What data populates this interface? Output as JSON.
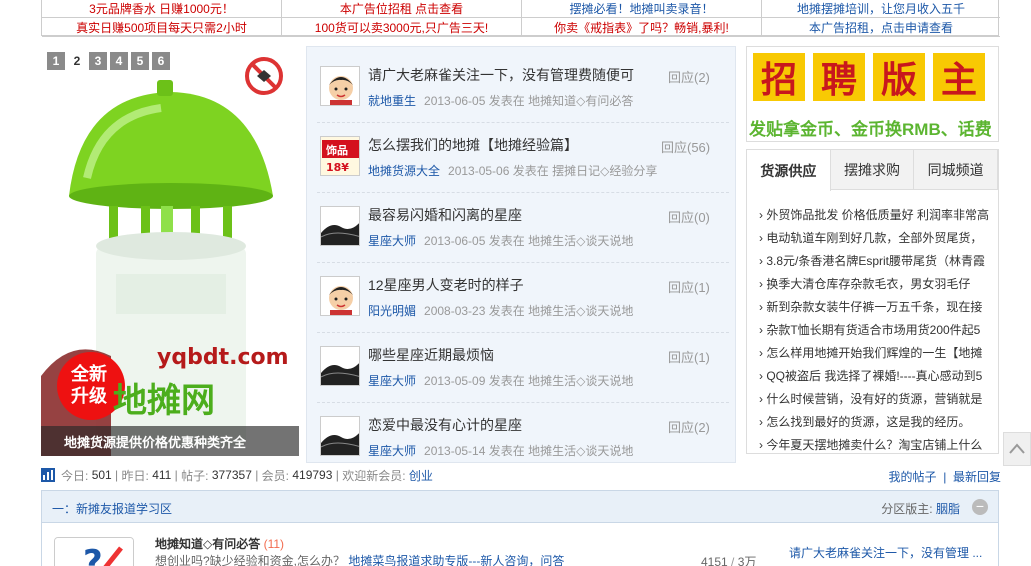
{
  "ad_strip": {
    "row1": [
      "3元品牌香水 日赚1000元！",
      "本广告位招租 点击查看",
      "摆摊必看！地摊叫卖录音！",
      "地摊摆摊培训，让您月收入五千"
    ],
    "row2": [
      "真实日赚500项目每天只需2小时",
      "100货可以卖3000元,只广告三天!",
      "你卖《戒指表》了吗？畅销,暴利!",
      "本广告招租，点击申请查看"
    ]
  },
  "slideshow": {
    "pages": [
      "1",
      "2",
      "3",
      "4",
      "5",
      "6"
    ],
    "current": "2",
    "caption": "地摊货源提供价格优惠种类齐全",
    "watermark": "yqbdt.com",
    "badge_line1": "全新",
    "badge_line2": "升级",
    "logo_text": "地摊网"
  },
  "threads": [
    {
      "title": "请广大老麻雀关注一下，没有管理费随便可",
      "reply": "回应(2)",
      "author": "就地重生",
      "date": "2013-06-05",
      "posted_in": "发表在",
      "forum": "地摊知道◇有问必答",
      "avatar": "cartoon-face"
    },
    {
      "title": "怎么摆我们的地摊【地摊经验篇】",
      "reply": "回应(56)",
      "author": "地摊货源大全",
      "date": "2013-05-06",
      "posted_in": "发表在",
      "forum": "摆摊日记◇经验分享",
      "avatar": "jewelry-logo",
      "avatar_text1": "饰品",
      "avatar_text2": "18¥"
    },
    {
      "title": "最容易闪婚和闪离的星座",
      "reply": "回应(0)",
      "author": "星座大师",
      "date": "2013-06-05",
      "posted_in": "发表在",
      "forum": "地摊生活◇谈天说地",
      "avatar": "landscape"
    },
    {
      "title": "12星座男人变老时的样子",
      "reply": "回应(1)",
      "author": "阳光明媚",
      "date": "2008-03-23",
      "posted_in": "发表在",
      "forum": "地摊生活◇谈天说地",
      "avatar": "cartoon-face"
    },
    {
      "title": "哪些星座近期最烦恼",
      "reply": "回应(1)",
      "author": "星座大师",
      "date": "2013-05-09",
      "posted_in": "发表在",
      "forum": "地摊生活◇谈天说地",
      "avatar": "landscape"
    },
    {
      "title": "恋爱中最没有心计的星座",
      "reply": "回应(2)",
      "author": "星座大师",
      "date": "2013-05-14",
      "posted_in": "发表在",
      "forum": "地摊生活◇谈天说地",
      "avatar": "landscape"
    }
  ],
  "recruit": {
    "chars": [
      "招",
      "聘",
      "版",
      "主"
    ],
    "subtitle": "发贴拿金币、金币换RMB、话费"
  },
  "tabs": {
    "labels": [
      "货源供应",
      "摆摊求购",
      "同城频道"
    ],
    "active": 0,
    "items": [
      "› 外贸饰品批发 价格低质量好 利润率非常高",
      "› 电动轨道车刚到好几款，全部外贸尾货，",
      "› 3.8元/条香港名牌Esprit腰带尾货（林青霞",
      "› 换季大清仓库存杂款毛衣，男女羽毛仔",
      "› 新到杂款女装牛仔裤一万五千条，现在接",
      "› 杂款T恤长期有货适合市场用货200件起5",
      "› 怎么样用地摊开始我们辉煌的一生【地摊",
      "› QQ被盗后 我选择了裸婚!----真心感动到5",
      "› 什么时候营销，没有好的货源，营销就是",
      "› 怎么找到最好的货源，这是我的经历。",
      "› 今年夏天摆地摊卖什么？淘宝店铺上什么"
    ]
  },
  "stats": {
    "today_label": "今日:",
    "today": "501",
    "yesterday_label": "昨日:",
    "yesterday": "411",
    "posts_label": "帖子:",
    "posts": "377357",
    "members_label": "会员:",
    "members": "419793",
    "welcome_label": "欢迎新会员:",
    "new_member": "创业",
    "my_posts": "我的帖子",
    "latest_reply": "最新回复"
  },
  "section": {
    "title": "一：新摊友报道学习区",
    "moderator_label": "分区版主:",
    "moderator": "胭脂",
    "toggle": "−",
    "forum": {
      "name": "地摊知道◇有问必答",
      "today_count": "(11)",
      "desc_prefix": "想创业吗?缺少经验和资金,怎么办？",
      "desc_link": "地摊菜鸟报道求助专版---新人咨询，问答",
      "topics": "4151",
      "sep": " / ",
      "posts": "3万",
      "last_post": "请广大老麻雀关注一下，没有管理 ..."
    }
  },
  "colors": {
    "link": "#1d58a8",
    "red": "#cc0000",
    "green": "#5cb531",
    "yellow": "#f8c903"
  }
}
